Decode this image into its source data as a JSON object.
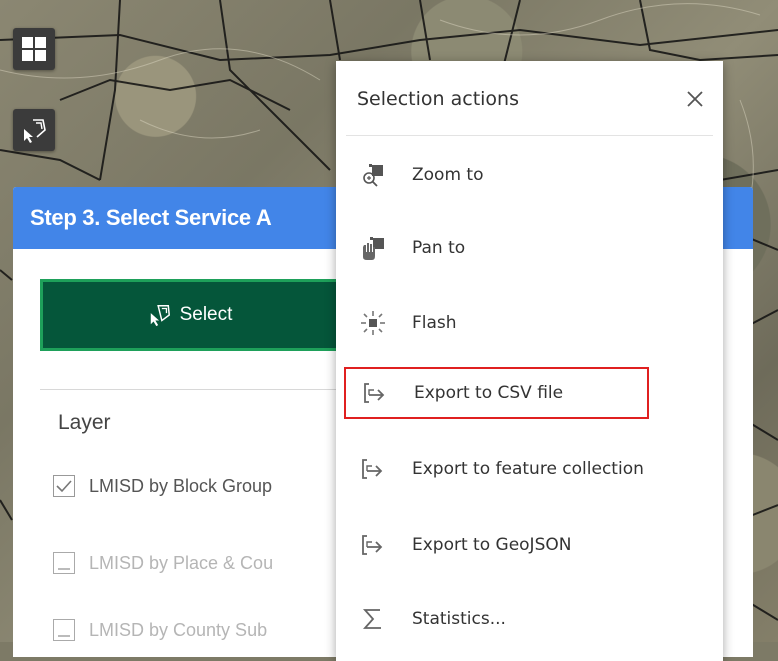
{
  "map_tools": [
    {
      "icon": "grid-icon"
    },
    {
      "icon": "select-features-icon"
    }
  ],
  "panel": {
    "title": "Step 3. Select Service A",
    "select_label": "Select",
    "layer_heading": "Layer",
    "layers": [
      {
        "label": "LMISD by Block Group",
        "checked": true,
        "enabled": true
      },
      {
        "label": "LMISD by Place & Cou",
        "checked": false,
        "enabled": false
      },
      {
        "label": "LMISD by County Sub",
        "checked": false,
        "enabled": false
      }
    ]
  },
  "selection_actions": {
    "title": "Selection actions",
    "items": [
      {
        "label": "Zoom to",
        "icon": "zoom-to-icon"
      },
      {
        "label": "Pan to",
        "icon": "pan-to-icon"
      },
      {
        "label": "Flash",
        "icon": "flash-icon"
      },
      {
        "label": "Export to CSV file",
        "icon": "export-icon",
        "highlighted": true
      },
      {
        "label": "Export to feature collection",
        "icon": "export-icon"
      },
      {
        "label": "Export to GeoJSON",
        "icon": "export-icon"
      },
      {
        "label": "Statistics...",
        "icon": "sigma-icon"
      }
    ]
  },
  "colors": {
    "header_blue": "#4285e8",
    "select_green": "#05563a",
    "select_border": "#1ea05a",
    "highlight_red": "#e02020"
  }
}
